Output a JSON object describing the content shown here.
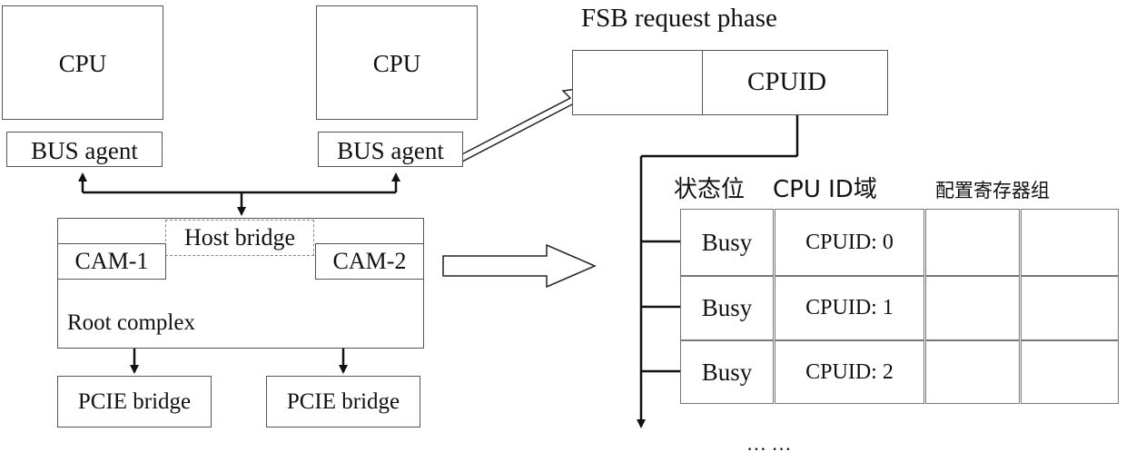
{
  "left_diagram": {
    "cpu_1": {
      "label": "CPU"
    },
    "cpu_2": {
      "label": "CPU"
    },
    "bus_agent_1": {
      "label": "BUS agent"
    },
    "bus_agent_2": {
      "label": "BUS agent"
    },
    "host_bridge": {
      "label": "Host bridge"
    },
    "cam_1": {
      "label": "CAM-1"
    },
    "cam_2": {
      "label": "CAM-2"
    },
    "root_complex": {
      "label": "Root complex"
    },
    "pcie_bridge_1": {
      "label": "PCIE bridge"
    },
    "pcie_bridge_2": {
      "label": "PCIE bridge"
    }
  },
  "fsb": {
    "title": "FSB request phase",
    "field_label": "CPUID"
  },
  "table": {
    "headers": {
      "status_bit": "状态位",
      "cpu_id_field": "CPU ID域",
      "config_registers": "配置寄存器组"
    },
    "rows": [
      {
        "status": "Busy",
        "cpuid": "CPUID: 0"
      },
      {
        "status": "Busy",
        "cpuid": "CPUID: 1"
      },
      {
        "status": "Busy",
        "cpuid": "CPUID: 2"
      }
    ],
    "ellipsis": "…  …"
  }
}
